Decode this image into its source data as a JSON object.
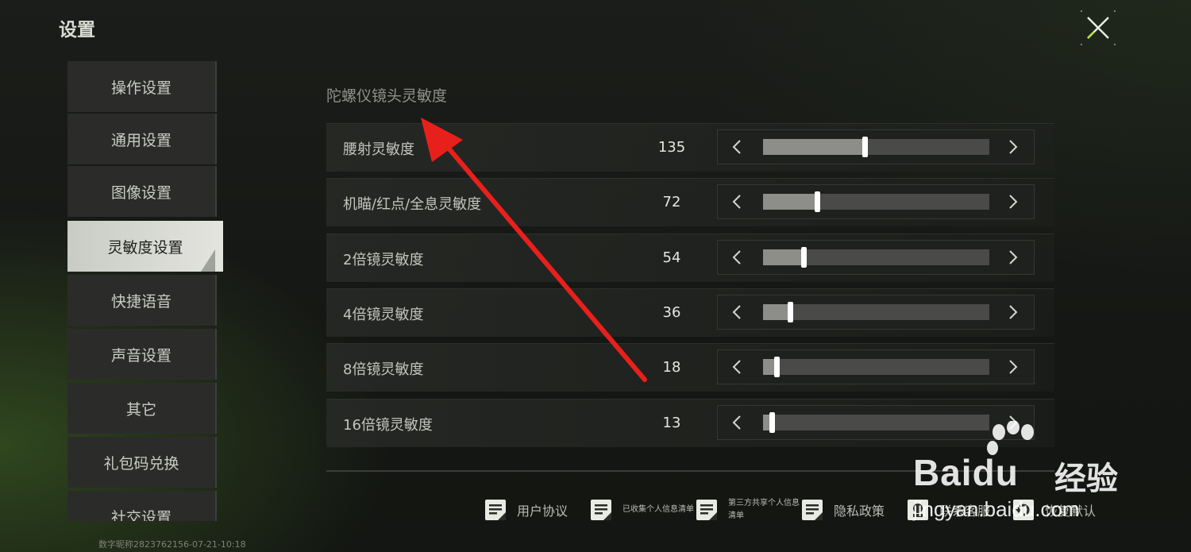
{
  "header": {
    "title": "设置"
  },
  "sidebar": {
    "items": [
      {
        "label": "操作设置"
      },
      {
        "label": "通用设置"
      },
      {
        "label": "图像设置"
      },
      {
        "label": "灵敏度设置",
        "active": true
      },
      {
        "label": "快捷语音"
      },
      {
        "label": "声音设置"
      },
      {
        "label": "其它"
      },
      {
        "label": "礼包码兑换"
      },
      {
        "label": "社交设置"
      }
    ]
  },
  "footer": {
    "id_text": "数字昵称2823762156-07-21-10:18"
  },
  "section": {
    "title": "陀螺仪镜头灵敏度"
  },
  "settings": [
    {
      "label": "腰射灵敏度",
      "value": "135",
      "level": 0.45
    },
    {
      "label": "机瞄/红点/全息灵敏度",
      "value": "72",
      "level": 0.24
    },
    {
      "label": "2倍镜灵敏度",
      "value": "54",
      "level": 0.18
    },
    {
      "label": "4倍镜灵敏度",
      "value": "36",
      "level": 0.12
    },
    {
      "label": "8倍镜灵敏度",
      "value": "18",
      "level": 0.06
    },
    {
      "label": "16倍镜灵敏度",
      "value": "13",
      "level": 0.04
    }
  ],
  "bottom_links": [
    {
      "label": "用户协议"
    },
    {
      "label": "已收集个人信息清单"
    },
    {
      "label": "第三方共享个人信息清单"
    },
    {
      "label": "隐私政策"
    },
    {
      "label": "联系客服"
    },
    {
      "label": "恢复默认"
    }
  ],
  "watermark": {
    "brand": "Bai",
    "brand2": "du",
    "cn": "经验",
    "url": "jingyan.baidu.com"
  },
  "colors": {
    "accent_close": "#b8e04a",
    "arrow": "#e8201c"
  }
}
